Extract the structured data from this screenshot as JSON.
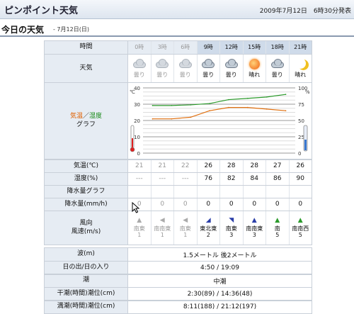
{
  "app": {
    "title": "ピンポイント天気",
    "datetime": "2009年7月12日　6時30分発表"
  },
  "section": {
    "title": "今日の天気",
    "date": "- 7月12日(日)"
  },
  "labels": {
    "time": "時間",
    "weather": "天気",
    "temp_part1": "気温",
    "temp_sep": "／",
    "temp_part2": "湿度",
    "graph": "グラフ",
    "temp_row": "気温(℃)",
    "humidity_row": "湿度(%)",
    "precip_graph_row": "降水量グラフ",
    "precip_row": "降水量(mm/h)",
    "wind_row_line1": "風向",
    "wind_row_line2": "風速(m/s)"
  },
  "hours": [
    "0時",
    "3時",
    "6時",
    "9時",
    "12時",
    "15時",
    "18時",
    "21時"
  ],
  "past_count": 3,
  "weather": [
    {
      "icon": "cloud-icon",
      "label": "曇り"
    },
    {
      "icon": "cloud-icon",
      "label": "曇り"
    },
    {
      "icon": "cloud-icon",
      "label": "曇り"
    },
    {
      "icon": "cloud-icon",
      "label": "曇り"
    },
    {
      "icon": "cloud-icon",
      "label": "曇り"
    },
    {
      "icon": "sun-icon",
      "label": "晴れ"
    },
    {
      "icon": "cloud-icon",
      "label": "曇り"
    },
    {
      "icon": "moon-icon",
      "label": "晴れ"
    }
  ],
  "temps": [
    "21",
    "21",
    "22",
    "26",
    "28",
    "28",
    "27",
    "26"
  ],
  "humidity": [
    "---",
    "---",
    "---",
    "76",
    "82",
    "84",
    "86",
    "90"
  ],
  "precip": [
    "0",
    "0",
    "0",
    "0",
    "0",
    "0",
    "0",
    "0"
  ],
  "wind": [
    {
      "arrow": "▲",
      "dir": "南東",
      "speed": "1"
    },
    {
      "arrow": "◀",
      "dir": "南南東",
      "speed": "1"
    },
    {
      "arrow": "◀",
      "dir": "南東",
      "speed": "1"
    },
    {
      "arrow": "◢",
      "dir": "東北東",
      "speed": "2"
    },
    {
      "arrow": "◥",
      "dir": "南東",
      "speed": "3"
    },
    {
      "arrow": "▲",
      "dir": "南南東",
      "speed": "3"
    },
    {
      "arrow": "▲",
      "dir": "南",
      "speed": "5"
    },
    {
      "arrow": "▲",
      "dir": "南南西",
      "speed": "5"
    }
  ],
  "colors": {
    "temp_label": "#e06000",
    "humidity_label": "#1a8a1a",
    "temp_line": "#e07010",
    "humidity_line": "#2a9a2a",
    "wind_arrow_present": "#2a3ea8",
    "wind_arrow_green": "#2a9a2a"
  },
  "chart_data": {
    "type": "line",
    "x": [
      "0時",
      "3時",
      "6時",
      "9時",
      "12時",
      "15時",
      "18時",
      "21時"
    ],
    "left_axis": {
      "label": "℃",
      "ticks": [
        0,
        10,
        20,
        30,
        40
      ],
      "range": [
        0,
        40
      ]
    },
    "right_axis": {
      "label": "%",
      "ticks": [
        0,
        25,
        50,
        75,
        100
      ],
      "range": [
        0,
        100
      ]
    },
    "series": [
      {
        "values": [
          21,
          21,
          22,
          26,
          28,
          28,
          27,
          26
        ],
        "axis": "left"
      },
      {
        "values": [
          73,
          73,
          74,
          76,
          82,
          84,
          86,
          90
        ],
        "axis": "right"
      }
    ],
    "grid": true
  },
  "lower": [
    {
      "label": "波(m)",
      "value": "1.5メートル 後2メートル"
    },
    {
      "label": "日の出/日の入り",
      "value": "4:50 / 19:09"
    },
    {
      "label": "潮",
      "value": "中潮"
    },
    {
      "label": "干潮(時間)潮位(cm)",
      "value": "2:30(89) / 14:36(48)"
    },
    {
      "label": "満潮(時間)潮位(cm)",
      "value": "8:11(188) / 21:12(197)"
    }
  ]
}
